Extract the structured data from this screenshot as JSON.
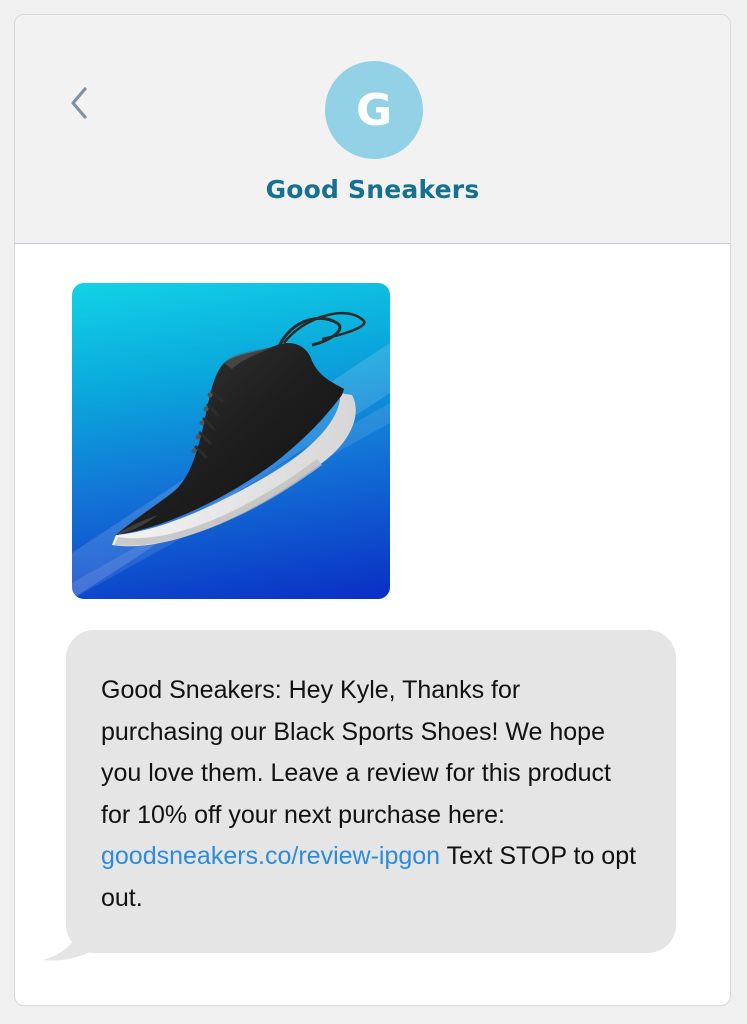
{
  "colors": {
    "accent": "#16708f",
    "avatar_bg": "#93d1e6",
    "back_arrow": "#7a93a8",
    "bubble_bg": "#e5e5e5",
    "link": "#2b8cdf"
  },
  "header": {
    "back_icon": "chevron-left-icon",
    "avatar_initial": "G",
    "contact_name": "Good Sneakers"
  },
  "conversation": {
    "image": {
      "subject": "black-sneaker-image"
    },
    "message": {
      "text_before_link": "Good Sneakers: Hey Kyle, Thanks for purchasing our Black Sports Shoes! We hope you love them. Leave a review for this product for 10% off your next purchase here: ",
      "link_text": "goodsneakers.co/review-ipgon",
      "text_after_link": " Text STOP to opt out."
    }
  }
}
